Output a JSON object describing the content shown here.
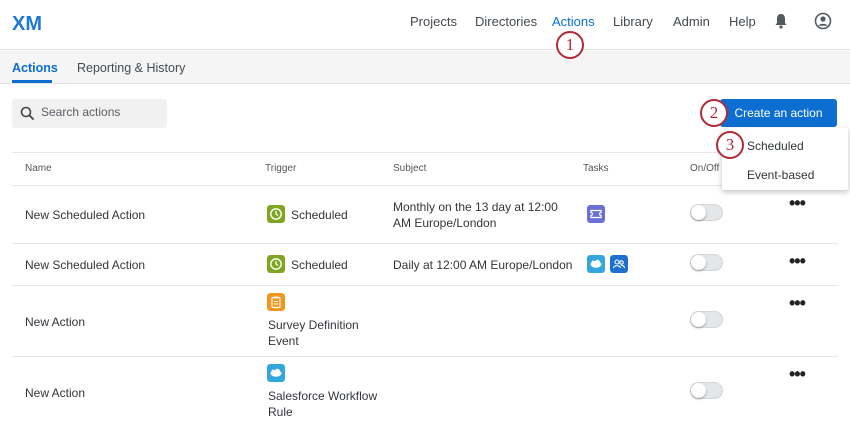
{
  "nav": {
    "logo": "XM",
    "items": [
      "Projects",
      "Directories",
      "Actions",
      "Library",
      "Admin",
      "Help"
    ]
  },
  "subtabs": [
    "Actions",
    "Reporting & History"
  ],
  "search": {
    "placeholder": "Search actions"
  },
  "create_button": "Create an action",
  "dropdown": [
    "Scheduled",
    "Event-based"
  ],
  "callouts": [
    "1",
    "2",
    "3"
  ],
  "table": {
    "headers": [
      "Name",
      "Trigger",
      "Subject",
      "Tasks",
      "On/Off"
    ],
    "rows": [
      {
        "name": "New Scheduled Action",
        "trigger": "Scheduled",
        "subject": "Monthly on the 13 day at 12:00 AM Europe/London",
        "on": false
      },
      {
        "name": "New Scheduled Action",
        "trigger": "Scheduled",
        "subject": "Daily at 12:00 AM Europe/London",
        "on": false
      },
      {
        "name": "New Action",
        "trigger": "Survey Definition Event",
        "subject": "",
        "on": false
      },
      {
        "name": "New Action",
        "trigger": "Salesforce Workflow Rule",
        "subject": "",
        "on": false
      }
    ]
  },
  "colors": {
    "accent": "#0b6ed0",
    "callout": "#b12a35",
    "scheduled_green": "#7fa521",
    "survey_orange": "#f2961f",
    "salesforce_blue": "#33a6dd",
    "task_purple": "#6b6fd6",
    "task_blue": "#1f6fd0"
  }
}
